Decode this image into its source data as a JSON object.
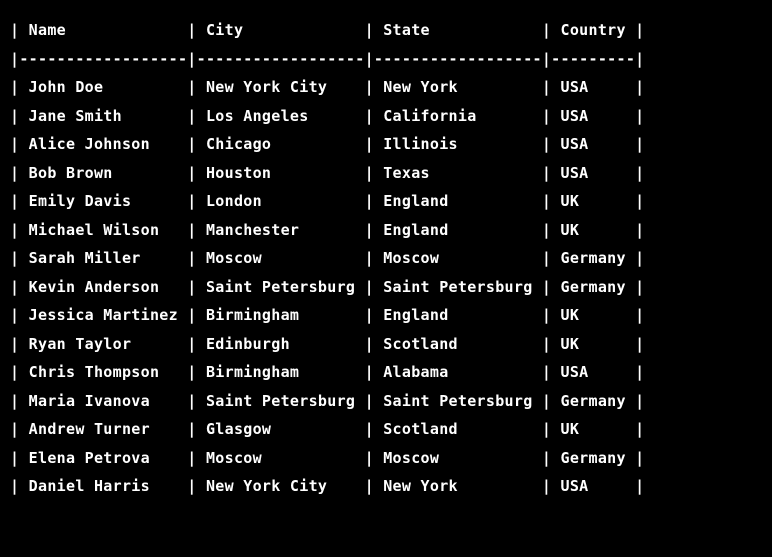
{
  "chart_data": {
    "type": "table",
    "columns": [
      "Name",
      "City",
      "State",
      "Country"
    ],
    "rows": [
      [
        "John Doe",
        "New York City",
        "New York",
        "USA"
      ],
      [
        "Jane Smith",
        "Los Angeles",
        "California",
        "USA"
      ],
      [
        "Alice Johnson",
        "Chicago",
        "Illinois",
        "USA"
      ],
      [
        "Bob Brown",
        "Houston",
        "Texas",
        "USA"
      ],
      [
        "Emily Davis",
        "London",
        "England",
        "UK"
      ],
      [
        "Michael Wilson",
        "Manchester",
        "England",
        "UK"
      ],
      [
        "Sarah Miller",
        "Moscow",
        "Moscow",
        "Germany"
      ],
      [
        "Kevin Anderson",
        "Saint Petersburg",
        "Saint Petersburg",
        "Germany"
      ],
      [
        "Jessica Martinez",
        "Birmingham",
        "England",
        "UK"
      ],
      [
        "Ryan Taylor",
        "Edinburgh",
        "Scotland",
        "UK"
      ],
      [
        "Chris Thompson",
        "Birmingham",
        "Alabama",
        "USA"
      ],
      [
        "Maria Ivanova",
        "Saint Petersburg",
        "Saint Petersburg",
        "Germany"
      ],
      [
        "Andrew Turner",
        "Glasgow",
        "Scotland",
        "UK"
      ],
      [
        "Elena Petrova",
        "Moscow",
        "Moscow",
        "Germany"
      ],
      [
        "Daniel Harris",
        "New York City",
        "New York",
        "USA"
      ]
    ]
  },
  "widths": [
    16,
    16,
    16,
    7
  ]
}
